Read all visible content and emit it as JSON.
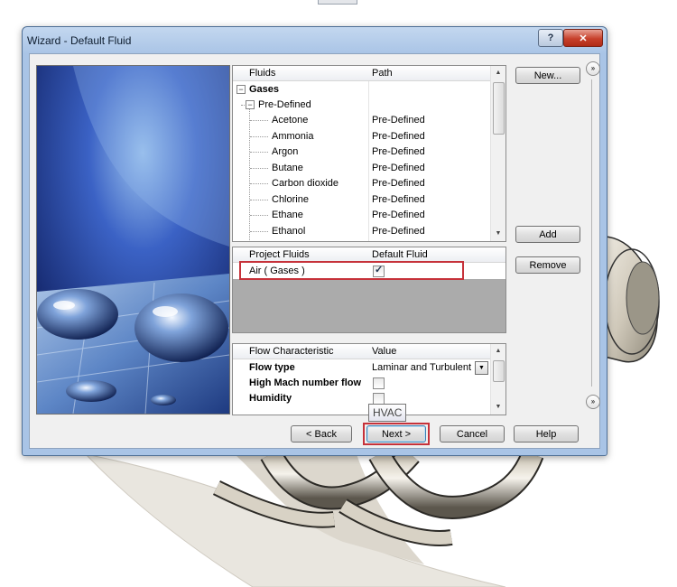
{
  "window": {
    "title": "Wizard - Default Fluid",
    "help_glyph": "?",
    "close_glyph": "✕"
  },
  "fluids_panel": {
    "headers": [
      "Fluids",
      "Path"
    ],
    "group": "Gases",
    "subgroup": "Pre-Defined",
    "rows": [
      {
        "name": "Acetone",
        "path": "Pre-Defined"
      },
      {
        "name": "Ammonia",
        "path": "Pre-Defined"
      },
      {
        "name": "Argon",
        "path": "Pre-Defined"
      },
      {
        "name": "Butane",
        "path": "Pre-Defined"
      },
      {
        "name": "Carbon dioxide",
        "path": "Pre-Defined"
      },
      {
        "name": "Chlorine",
        "path": "Pre-Defined"
      },
      {
        "name": "Ethane",
        "path": "Pre-Defined"
      },
      {
        "name": "Ethanol",
        "path": "Pre-Defined"
      }
    ]
  },
  "project_panel": {
    "headers": [
      "Project Fluids",
      "Default Fluid"
    ],
    "rows": [
      {
        "name": "Air ( Gases )",
        "default": true
      }
    ]
  },
  "flow_panel": {
    "headers": [
      "Flow Characteristic",
      "Value"
    ],
    "rows": [
      {
        "name": "Flow type",
        "value": "Laminar and Turbulent",
        "kind": "dropdown"
      },
      {
        "name": "High Mach number flow",
        "kind": "checkbox",
        "checked": false
      },
      {
        "name": "Humidity",
        "kind": "checkbox",
        "checked": false
      }
    ]
  },
  "side_buttons": {
    "new": "New...",
    "add": "Add",
    "remove": "Remove",
    "expand_glyph": "»"
  },
  "footer": {
    "back": "< Back",
    "next": "Next >",
    "cancel": "Cancel",
    "help": "Help"
  },
  "tooltip": "HVAC",
  "colors": {
    "highlight_outline": "#c6323a",
    "title_bar": "#a9c4e6",
    "close_button": "#c7402b"
  },
  "icons": {
    "expand": "minus-box-icon",
    "scroll_up": "triangle-up-icon",
    "scroll_down": "triangle-down-icon",
    "dropdown": "triangle-down-icon",
    "panel_toggle": "double-chevron-right-icon"
  }
}
